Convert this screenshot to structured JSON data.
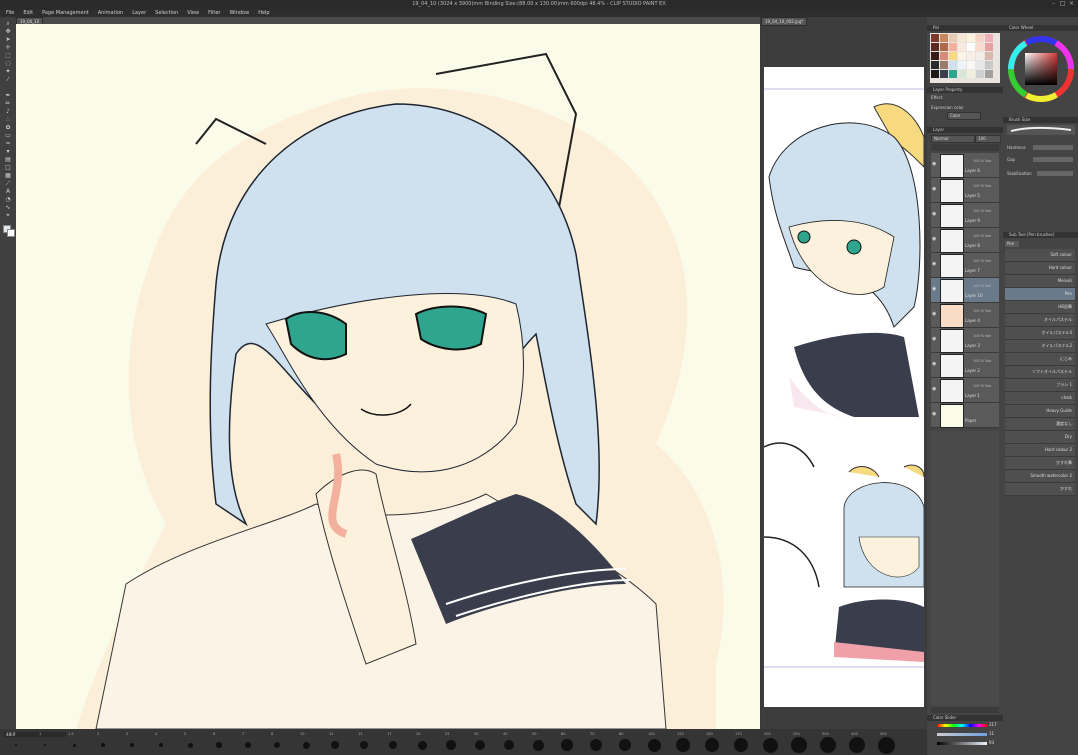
{
  "window": {
    "title": "19_04_10 (3024 x 3900)mm Binding Size:(88.00 x 130.00)mm 600dpi 48.4% - CLIP STUDIO PAINT EX"
  },
  "menu": [
    "File",
    "Edit",
    "Page Management",
    "Animation",
    "Layer",
    "Selection",
    "View",
    "Filter",
    "Window",
    "Help"
  ],
  "tabs": {
    "canvas1": "19_04_10",
    "canvas2": "19_04_10_002.jpg*"
  },
  "panels": {
    "palette_tab": "Pal",
    "color_wheel": "Color Wheel",
    "layer_property": "Layer Property",
    "effect": "Effect",
    "expression_color": "Expression color",
    "expression_value": "Color",
    "layer_tab": "Layer",
    "blend_mode": "Normal",
    "opacity": "100",
    "brush_size": "Brush Size",
    "hardness": "Hardness",
    "gap": "Gap",
    "stabilization": "Stabilization",
    "subtool_header": "Sub Tool [Pen brushes]",
    "subtool_tab": "Pen",
    "color_slider": "Color Slider"
  },
  "layers": [
    {
      "name": "Layer 6",
      "blend": "100 % Nor"
    },
    {
      "name": "Layer 5",
      "blend": "100 % Nor"
    },
    {
      "name": "Layer 9",
      "blend": "100 % Nor"
    },
    {
      "name": "Layer 8",
      "blend": "100 % Nor"
    },
    {
      "name": "Layer 7",
      "blend": "100 % Nor"
    },
    {
      "name": "Layer 10",
      "blend": "100 % Nor"
    },
    {
      "name": "Layer 4",
      "blend": "100 % Nor"
    },
    {
      "name": "Layer 3",
      "blend": "100 % Nor"
    },
    {
      "name": "Layer 2",
      "blend": "100 % Nor"
    },
    {
      "name": "Layer 1",
      "blend": "100 % Nor"
    },
    {
      "name": "Paper",
      "blend": ""
    }
  ],
  "brushes": [
    "Soft colour",
    "Hard colour",
    "Menuki",
    "Pen",
    "HB鉛筆",
    "オイルパステル",
    "オイルパステル4",
    "オイルパステル2",
    "にじみ",
    "ソフトオイルパステル",
    "ブラシ 1",
    "chalk",
    "Heavy Guide",
    "濃度なし",
    "Dry",
    "Hard colour 2",
    "かすれ筆",
    "Smooth watercolor 2",
    "かすれ"
  ],
  "colors": {
    "hair": "#cfe1ee",
    "skin": "#fbf1dc",
    "uniform": "#3a3e4c",
    "blush": "#f3b09c",
    "eye": "#2fa58d",
    "bow": "#f7d980"
  },
  "statusbar": {
    "zoom": "48.4",
    "sizes": [
      "0.7",
      "1",
      "1.5",
      "2",
      "3",
      "4",
      "5",
      "6",
      "7",
      "8",
      "10",
      "12",
      "15",
      "17",
      "20",
      "25",
      "30",
      "40",
      "50",
      "60",
      "70",
      "80",
      "100",
      "120",
      "150",
      "170",
      "200",
      "250",
      "300",
      "400",
      "500"
    ]
  },
  "color_slider": {
    "h": "217",
    "s": "11",
    "v": "93"
  }
}
